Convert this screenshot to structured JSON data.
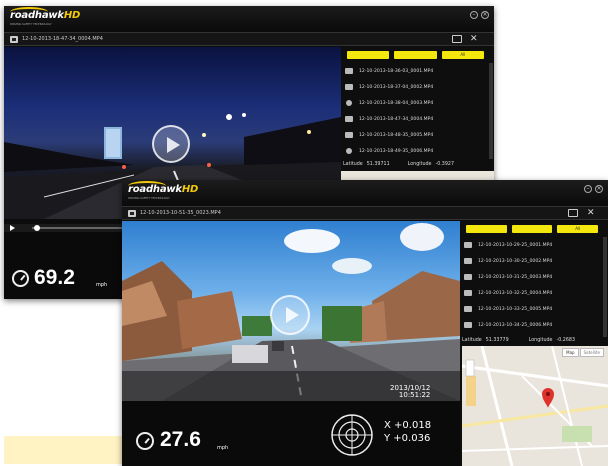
{
  "brand": {
    "logo_main": "roadhawk",
    "logo_suffix": "HD",
    "tagline": "DRIVING SAFETY TECHNOLOGY"
  },
  "colors": {
    "accent": "#f3e70d",
    "logo_swoosh": "#f2c90a",
    "background": "#0c0c0c"
  },
  "icons": [
    "video-file-icon",
    "folder-icon",
    "tools-icon",
    "minimize-icon",
    "close-icon",
    "play-icon",
    "speedometer-icon",
    "gsensor-crosshair-icon"
  ],
  "window1": {
    "filename": "12-10-2013-18-47-34_0004.MP4",
    "buttons": [
      "",
      "",
      "All"
    ],
    "files": [
      "12-10-2013-18-36-03_0001.MP4",
      "12-10-2013-18-37-04_0002.MP4",
      "12-10-2013-18-38-04_0003.MP4",
      "12-10-2013-18-47-34_0004.MP4",
      "12-10-2013-18-48-35_0005.MP4",
      "12-10-2013-18-49-35_0006.MP4"
    ],
    "latitude_label": "Latitude",
    "latitude_value": "51.39711",
    "longitude_label": "Longitude",
    "longitude_value": "-0.3927",
    "speed": "69.2",
    "speed_unit": "mph"
  },
  "window2": {
    "filename": "12-10-2013-10-51-35_0023.MP4",
    "buttons": [
      "",
      "",
      "All"
    ],
    "files": [
      "12-10-2013-10-29-25_0001.MP4",
      "12-10-2013-10-30-25_0002.MP4",
      "12-10-2013-10-31-25_0003.MP4",
      "12-10-2013-10-32-25_0004.MP4",
      "12-10-2013-10-33-25_0005.MP4",
      "12-10-2013-10-34-25_0006.MP4"
    ],
    "latitude_label": "Latitude",
    "latitude_value": "51.33779",
    "longitude_label": "Longitude",
    "longitude_value": "-0.2683",
    "map_tabs": [
      "Map",
      "Satellite"
    ],
    "timestamp_date": "2013/10/12",
    "timestamp_time": "10:51:22",
    "speed": "27.6",
    "speed_unit": "mph",
    "x_label": "X",
    "x_value": "+0.018",
    "y_label": "Y",
    "y_value": "+0.036"
  }
}
